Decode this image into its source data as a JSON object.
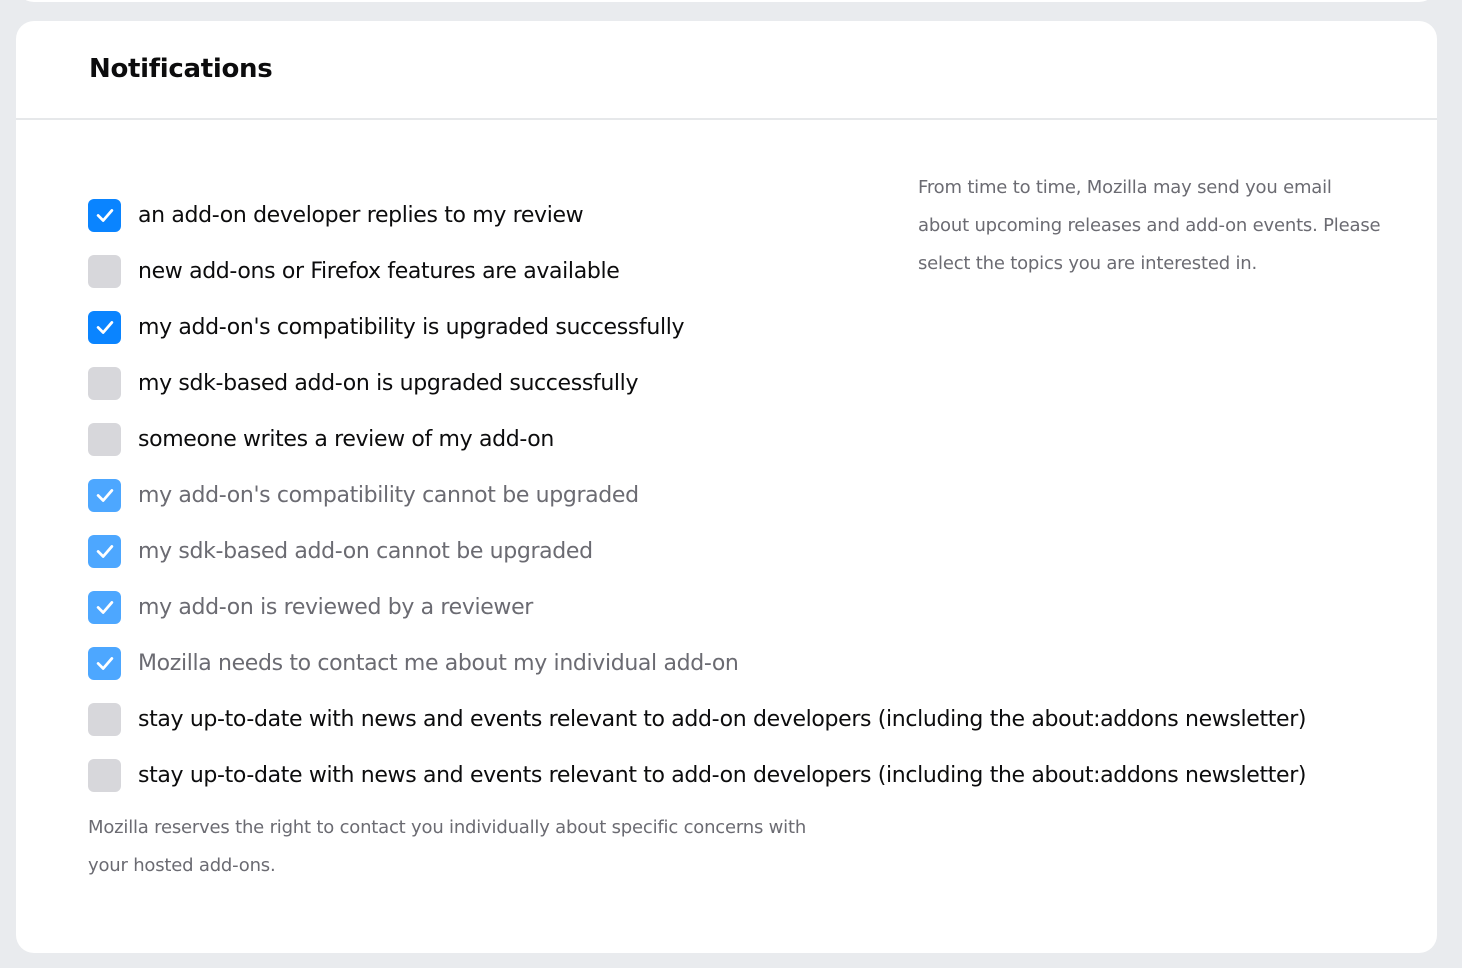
{
  "section": {
    "title": "Notifications",
    "help_text": "From time to time, Mozilla may send you email about upcoming releases and add-on events. Please select the topics you are interested in.",
    "footnote": "Mozilla reserves the right to contact you individually about specific concerns with your hosted add-ons."
  },
  "options": [
    {
      "label": "an add-on developer replies to my review",
      "checked": true,
      "disabled": false
    },
    {
      "label": "new add-ons or Firefox features are available",
      "checked": false,
      "disabled": false
    },
    {
      "label": "my add-on's compatibility is upgraded successfully",
      "checked": true,
      "disabled": false
    },
    {
      "label": "my sdk-based add-on is upgraded successfully",
      "checked": false,
      "disabled": false
    },
    {
      "label": "someone writes a review of my add-on",
      "checked": false,
      "disabled": false
    },
    {
      "label": "my add-on's compatibility cannot be upgraded",
      "checked": true,
      "disabled": true
    },
    {
      "label": "my sdk-based add-on cannot be upgraded",
      "checked": true,
      "disabled": true
    },
    {
      "label": "my add-on is reviewed by a reviewer",
      "checked": true,
      "disabled": true
    },
    {
      "label": "Mozilla needs to contact me about my individual add-on",
      "checked": true,
      "disabled": true
    },
    {
      "label": "stay up-to-date with news and events relevant to add-on developers (including the about:addons newsletter)",
      "checked": false,
      "disabled": false
    },
    {
      "label": "stay up-to-date with news and events relevant to add-on developers (including the about:addons newsletter)",
      "checked": false,
      "disabled": false
    }
  ],
  "colors": {
    "checked": "#0a84ff",
    "checked_disabled": "#4da7ff",
    "unchecked": "#d7d7db",
    "text": "#0c0c0d",
    "muted_text": "#6b6b72"
  },
  "icons": {
    "check": "checkmark-icon"
  }
}
